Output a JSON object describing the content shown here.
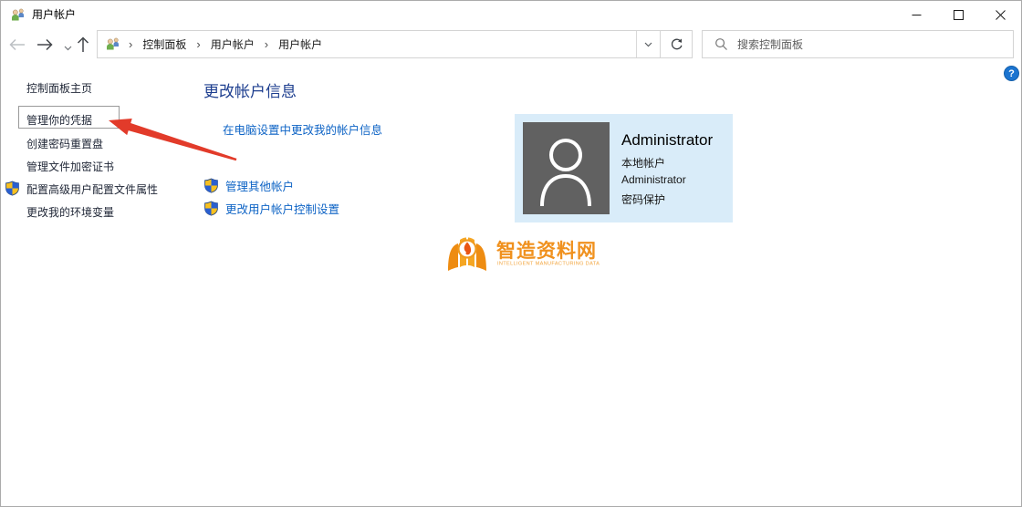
{
  "window": {
    "title": "用户帐户"
  },
  "toolbar": {
    "breadcrumb": {
      "separator": "›",
      "items": [
        "控制面板",
        "用户帐户",
        "用户帐户"
      ]
    },
    "search": {
      "placeholder": "搜索控制面板",
      "value": ""
    }
  },
  "help": {
    "label": "?"
  },
  "sidebar": {
    "items": [
      {
        "label": "控制面板主页"
      },
      {
        "label": "管理你的凭据"
      },
      {
        "label": "创建密码重置盘"
      },
      {
        "label": "管理文件加密证书"
      },
      {
        "label": "配置高级用户配置文件属性"
      },
      {
        "label": "更改我的环境变量"
      }
    ]
  },
  "main": {
    "heading": "更改帐户信息",
    "links": [
      {
        "label": "在电脑设置中更改我的帐户信息"
      },
      {
        "label": "管理其他帐户"
      },
      {
        "label": "更改用户帐户控制设置"
      }
    ],
    "account": {
      "name": "Administrator",
      "details": [
        "本地帐户",
        "Administrator",
        "密码保护"
      ]
    }
  },
  "watermark": {
    "title": "智造资料网",
    "subtitle": "INTELLIGENT MANUFACTURING DATA"
  },
  "icons": {
    "app": "users-icon",
    "shield": "uac-shield-icon",
    "search": "magnifier-icon",
    "refresh": "refresh-icon",
    "back": "arrow-left-icon",
    "forward": "arrow-right-icon",
    "up": "arrow-up-icon",
    "dropdown": "chevron-down-icon",
    "help": "question-mark-icon",
    "avatar": "person-silhouette-icon",
    "annotation": "red-arrow"
  },
  "colors": {
    "heading_blue": "#1d3e8f",
    "link_blue": "#0d63c5",
    "panel_bg": "#d9ecf9",
    "avatar_gray": "#616161",
    "arrow_red": "#e23b2a",
    "watermark_orange": "#f0911e",
    "help_blue": "#1b74d0"
  }
}
